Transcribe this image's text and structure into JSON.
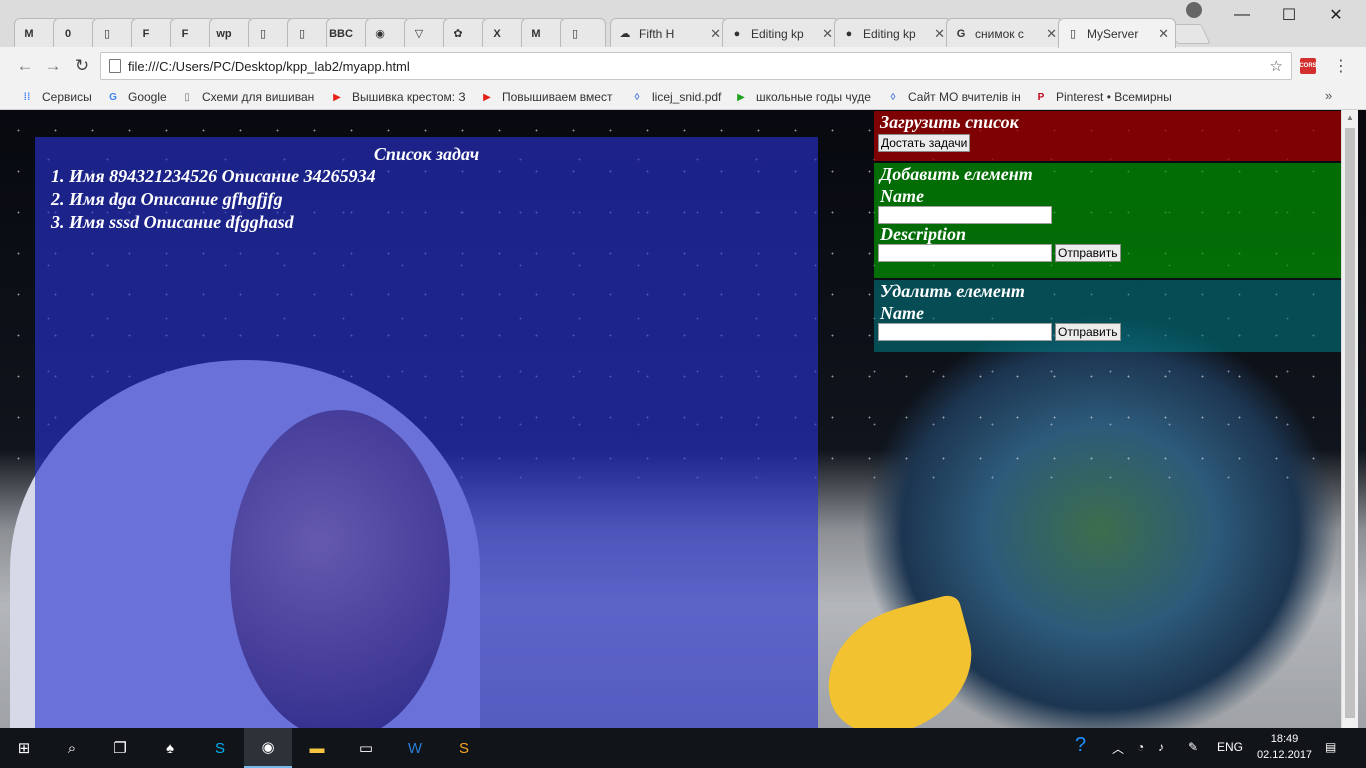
{
  "browser": {
    "tabs": [
      {
        "icon": "medium-icon",
        "glyph": "M",
        "title": ""
      },
      {
        "icon": "onenote-icon",
        "glyph": "0",
        "title": ""
      },
      {
        "icon": "page-icon",
        "glyph": "▯",
        "title": ""
      },
      {
        "icon": "f-icon",
        "glyph": "F",
        "title": ""
      },
      {
        "icon": "f-icon",
        "glyph": "F",
        "title": ""
      },
      {
        "icon": "wp-icon",
        "glyph": "wp",
        "title": ""
      },
      {
        "icon": "page-icon",
        "glyph": "▯",
        "title": ""
      },
      {
        "icon": "page-icon",
        "glyph": "▯",
        "title": ""
      },
      {
        "icon": "bbc-icon",
        "glyph": "BBC",
        "title": ""
      },
      {
        "icon": "chrome-color-icon",
        "glyph": "◉",
        "title": ""
      },
      {
        "icon": "triangle-icon",
        "glyph": "▽",
        "title": ""
      },
      {
        "icon": "bee-icon",
        "glyph": "✿",
        "title": ""
      },
      {
        "icon": "x-icon",
        "glyph": "X",
        "title": ""
      },
      {
        "icon": "medium-icon",
        "glyph": "M",
        "title": ""
      },
      {
        "icon": "page-icon",
        "glyph": "▯",
        "title": ""
      },
      {
        "icon": "soundcloud-icon",
        "glyph": "☁",
        "title": "Fifth H"
      },
      {
        "icon": "github-icon",
        "glyph": "●",
        "title": "Editing kp"
      },
      {
        "icon": "github-icon",
        "glyph": "●",
        "title": "Editing kp"
      },
      {
        "icon": "google-icon",
        "glyph": "G",
        "title": "снимок с"
      },
      {
        "icon": "page-icon",
        "glyph": "▯",
        "title": "MyServer"
      }
    ],
    "url": "file:///C:/Users/PC/Desktop/kpp_lab2/myapp.html",
    "bookmarks": [
      {
        "icon": "apps-icon",
        "glyph": "⁞⁞",
        "label": "Сервисы"
      },
      {
        "icon": "google-icon",
        "glyph": "G",
        "label": "Google"
      },
      {
        "icon": "page-icon",
        "glyph": "▯",
        "label": "Схеми для вишиван"
      },
      {
        "icon": "youtube-icon",
        "glyph": "▶",
        "label": "Вышивка крестом: З"
      },
      {
        "icon": "youtube-icon",
        "glyph": "▶",
        "label": "Повышиваем вмест"
      },
      {
        "icon": "drive-icon",
        "glyph": "◊",
        "label": "licej_snid.pdf"
      },
      {
        "icon": "play-icon",
        "glyph": "▶",
        "label": "школьные годы чуде"
      },
      {
        "icon": "drive-icon",
        "glyph": "◊",
        "label": "Сайт МО вчителів ін"
      },
      {
        "icon": "pinterest-icon",
        "glyph": "P",
        "label": "Pinterest • Всемирны"
      }
    ],
    "extension_label": "CORS"
  },
  "app": {
    "task_list": {
      "title": "Список задач",
      "items": [
        "1. Имя 894321234526 Описание 34265934",
        "2. Имя dga Описание gfhgfjfg",
        "3. Имя sssd Описание dfgghasd"
      ]
    },
    "load": {
      "title": "Загрузить список",
      "button": "Достать задачи"
    },
    "add": {
      "title": "Добавить елемент",
      "name_label": "Name",
      "name_value": "",
      "description_label": "Description",
      "description_value": "",
      "submit": "Отправить"
    },
    "delete": {
      "title": "Удалить елемент",
      "name_label": "Name",
      "name_value": "",
      "submit": "Отправить"
    }
  },
  "taskbar": {
    "language": "ENG",
    "time": "18:49",
    "date": "02.12.2017"
  },
  "colors": {
    "task_panel": "#3b44c8",
    "load_panel": "#9c0000",
    "add_panel": "#008f00",
    "delete_panel": "#0f7b82"
  }
}
